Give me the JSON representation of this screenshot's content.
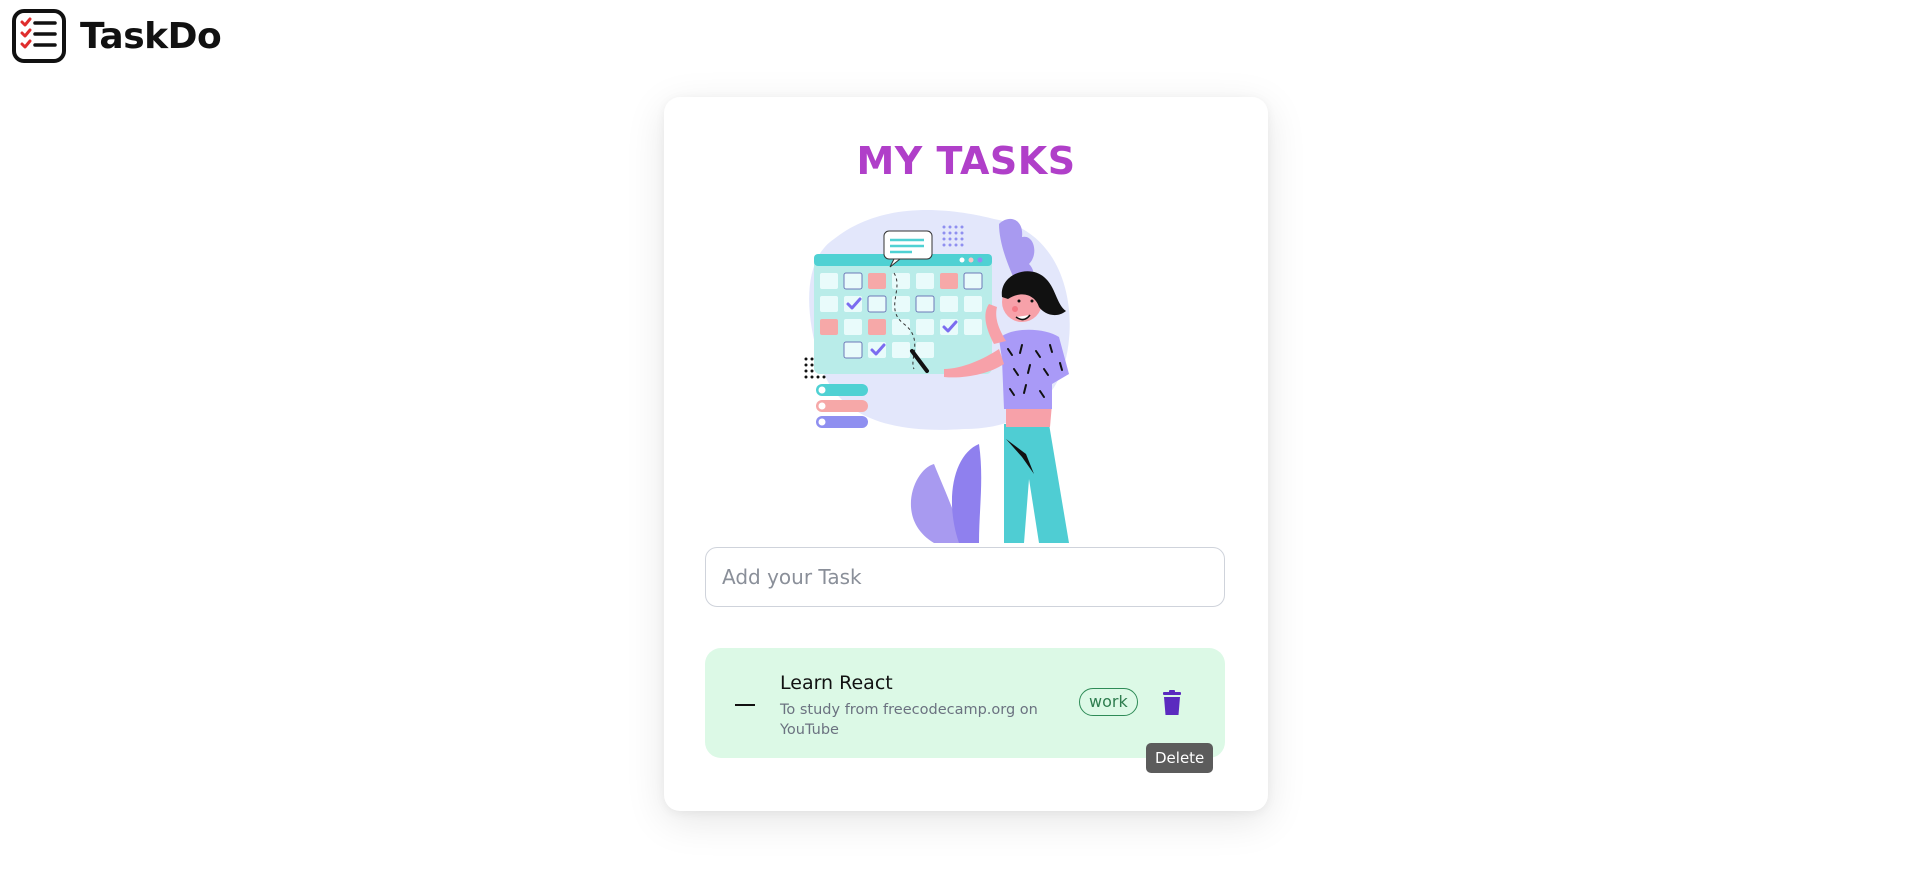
{
  "app": {
    "name": "TaskDo",
    "icon": "checklist-icon"
  },
  "page": {
    "title": "MY TASKS",
    "illustration": "woman-with-calendar-illustration"
  },
  "input": {
    "placeholder": "Add your Task",
    "value": ""
  },
  "tasks": [
    {
      "title": "Learn React",
      "description": "To study from freecodecamp.org on YouTube",
      "tag": "work",
      "delete_icon": "trash-icon"
    }
  ],
  "tooltip": {
    "text": "Delete"
  },
  "colors": {
    "title": "#b03fc9",
    "task_bg": "#dcf9e6",
    "tag_border": "#2e8b57",
    "delete_icon": "#5b2bbf",
    "logo_checks": "#e02d2d"
  }
}
